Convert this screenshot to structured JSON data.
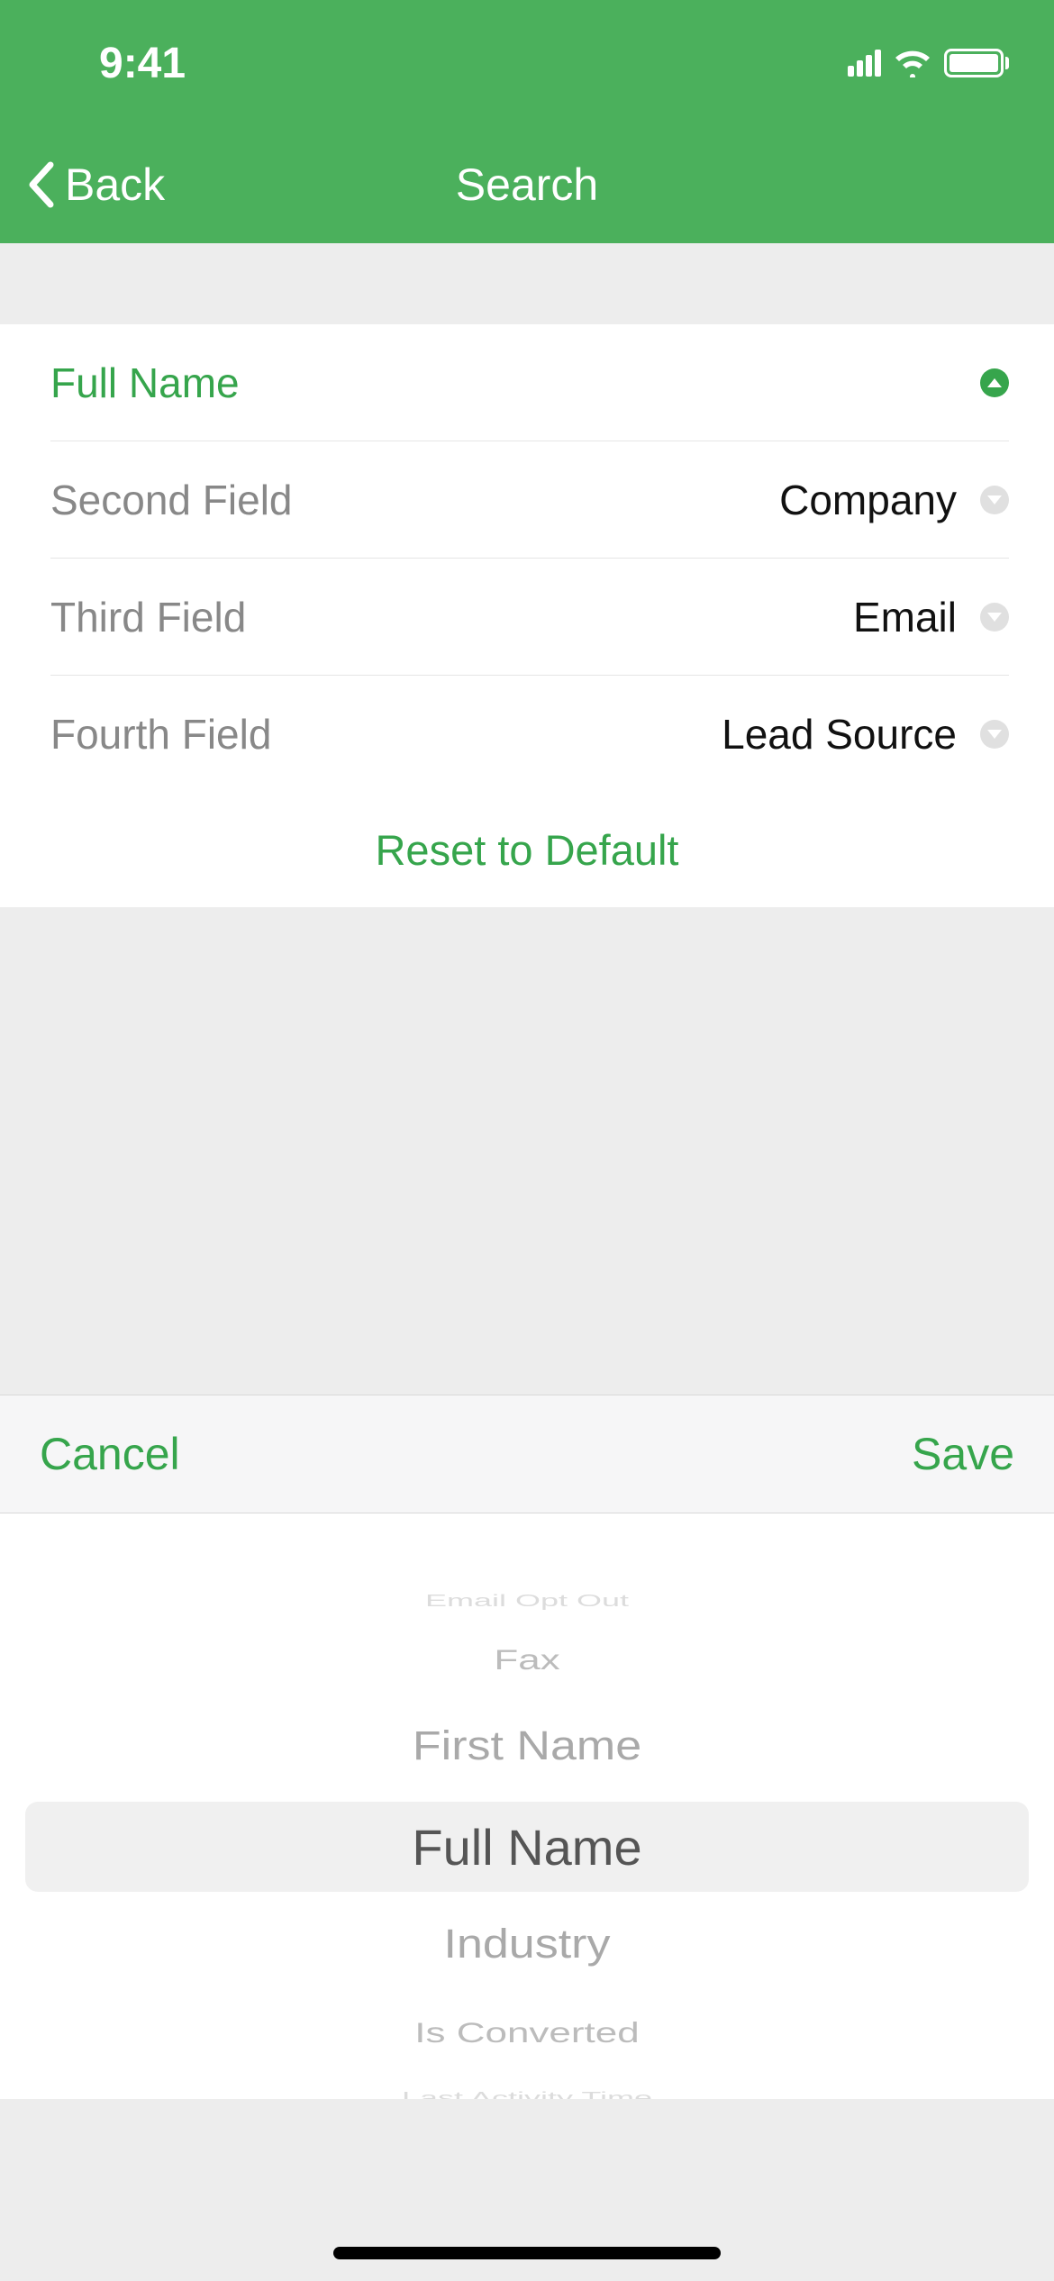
{
  "status": {
    "time": "9:41"
  },
  "nav": {
    "back_label": "Back",
    "title": "Search"
  },
  "fields": {
    "first": {
      "label": "Full Name"
    },
    "second": {
      "label": "Second Field",
      "value": "Company"
    },
    "third": {
      "label": "Third Field",
      "value": "Email"
    },
    "fourth": {
      "label": "Fourth Field",
      "value": "Lead Source"
    }
  },
  "reset_label": "Reset to Default",
  "picker": {
    "cancel_label": "Cancel",
    "save_label": "Save",
    "items": {
      "i0": "Email Opt Out",
      "i1": "Fax",
      "i2": "First Name",
      "i3": "Full Name",
      "i4": "Industry",
      "i5": "Is Converted",
      "i6": "Last Activity Time"
    }
  }
}
